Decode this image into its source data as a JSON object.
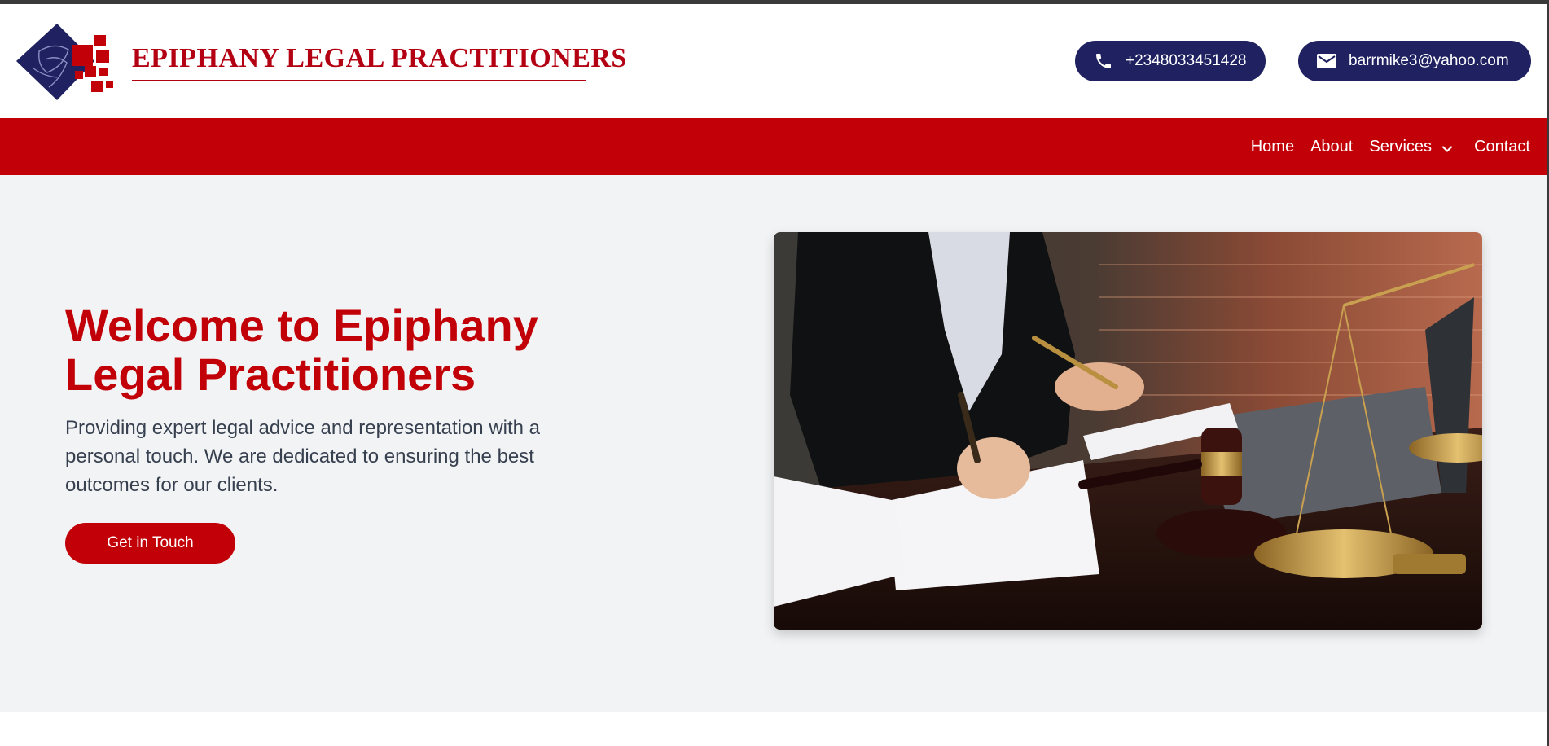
{
  "brand": {
    "title": "EPIPHANY LEGAL PRACTITIONERS",
    "logo_icon": "diamond-logo-icon",
    "colors": {
      "red": "#c10007",
      "navy": "#1f2160"
    }
  },
  "contact": {
    "phone": "+2348033451428",
    "phone_icon": "phone-icon",
    "email": "barrmike3@yahoo.com",
    "email_icon": "mail-icon"
  },
  "nav": {
    "items": [
      {
        "label": "Home"
      },
      {
        "label": "About"
      },
      {
        "label": "Services",
        "icon": "chevron-down-icon"
      },
      {
        "label": "Contact"
      }
    ]
  },
  "hero": {
    "title": "Welcome to Epiphany Legal Practitioners",
    "text": "Providing expert legal advice and representation with a personal touch. We are dedicated to ensuring the best outcomes for our clients.",
    "cta_label": "Get in Touch",
    "image": "lawyers-signing-documents-with-gavel-and-scales-photo"
  }
}
